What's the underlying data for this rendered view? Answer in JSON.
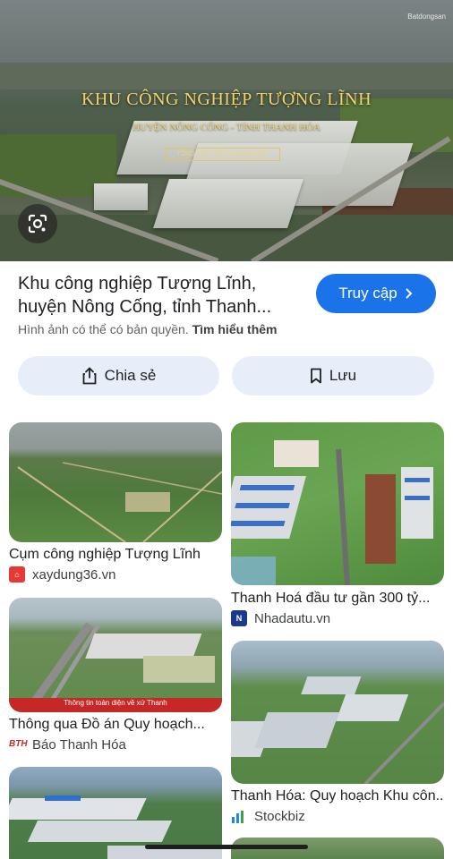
{
  "hero": {
    "title": "KHU CÔNG NGHIỆP TƯỢNG LĨNH",
    "subtitle": "HUYỆN NÔNG CỐNG - TỈNH THANH HÓA",
    "tag": "TỔNG HỢP BỞI DUAN24H.NET",
    "watermark": "Batdongsan",
    "lens_icon": "google-lens-icon"
  },
  "result": {
    "title": "Khu công nghiệp Tượng Lĩnh, huyện Nông Cống, tỉnh Thanh...",
    "visit_label": "Truy cập",
    "copyright_text": "Hình ảnh có thể có bản quyền.",
    "learn_more": "Tìm hiểu thêm"
  },
  "actions": {
    "share_label": "Chia sẻ",
    "save_label": "Lưu"
  },
  "related": [
    {
      "caption": "Cụm công nghiệp Tượng Lĩnh",
      "source": "xaydung36.vn"
    },
    {
      "caption": "Thanh Hoá đầu tư gần 300 tỷ...",
      "source": "Nhadautu.vn"
    },
    {
      "caption": "Thông qua Đồ án Quy hoạch...",
      "source": "Báo Thanh Hóa"
    },
    {
      "caption": "Thanh Hóa: Quy hoạch Khu côn...",
      "source": "Stockbiz"
    }
  ],
  "banner_text": "Thông tin toàn diện về xứ Thanh",
  "colors": {
    "accent": "#1a73e8",
    "pill_bg": "#e8eef9"
  }
}
